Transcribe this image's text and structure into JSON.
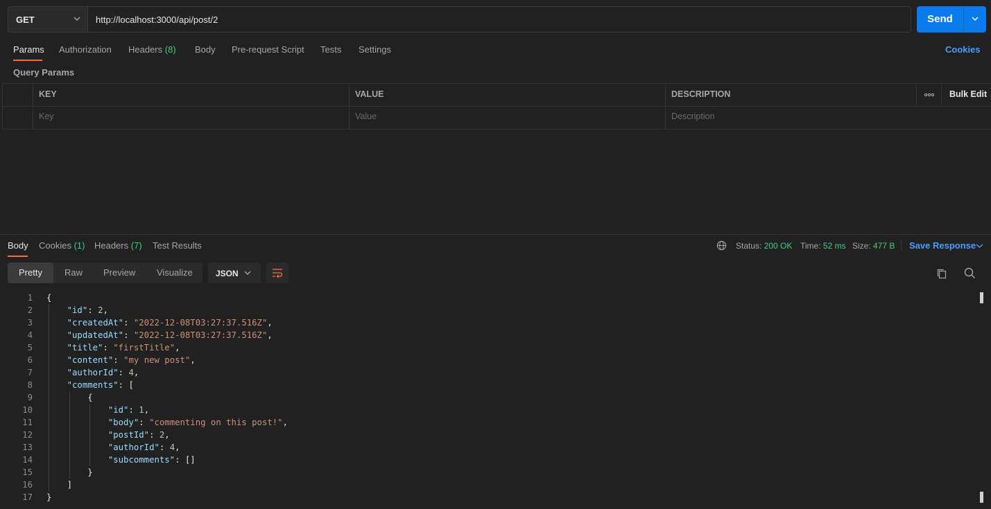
{
  "request": {
    "method": "GET",
    "url": "http://localhost:3000/api/post/2",
    "send_label": "Send"
  },
  "request_tabs": [
    {
      "label": "Params",
      "count": ""
    },
    {
      "label": "Authorization",
      "count": ""
    },
    {
      "label": "Headers",
      "count": "(8)"
    },
    {
      "label": "Body",
      "count": ""
    },
    {
      "label": "Pre-request Script",
      "count": ""
    },
    {
      "label": "Tests",
      "count": ""
    },
    {
      "label": "Settings",
      "count": ""
    }
  ],
  "cookies_link": "Cookies",
  "query_params": {
    "title": "Query Params",
    "columns": [
      "KEY",
      "VALUE",
      "DESCRIPTION"
    ],
    "placeholders": [
      "Key",
      "Value",
      "Description"
    ],
    "bulk_edit": "Bulk Edit"
  },
  "response_tabs": [
    {
      "label": "Body",
      "count": ""
    },
    {
      "label": "Cookies",
      "count": "(1)"
    },
    {
      "label": "Headers",
      "count": "(7)"
    },
    {
      "label": "Test Results",
      "count": ""
    }
  ],
  "response_status": {
    "status_label": "Status:",
    "status_value": "200 OK",
    "time_label": "Time:",
    "time_value": "52 ms",
    "size_label": "Size:",
    "size_value": "477 B",
    "save_label": "Save Response"
  },
  "view_modes": [
    "Pretty",
    "Raw",
    "Preview",
    "Visualize"
  ],
  "format": "JSON",
  "code_lines": [
    "{",
    "    \"id\": 2,",
    "    \"createdAt\": \"2022-12-08T03:27:37.516Z\",",
    "    \"updatedAt\": \"2022-12-08T03:27:37.516Z\",",
    "    \"title\": \"firstTitle\",",
    "    \"content\": \"my new post\",",
    "    \"authorId\": 4,",
    "    \"comments\": [",
    "        {",
    "            \"id\": 1,",
    "            \"body\": \"commenting on this post!\",",
    "            \"postId\": 2,",
    "            \"authorId\": 4,",
    "            \"subcomments\": []",
    "        }",
    "    ]",
    "}"
  ],
  "colors": {
    "accent": "#ff6c37",
    "send": "#097bed",
    "link": "#4a9eff",
    "status_ok": "#3bd27a",
    "json_key": "#9cdcfe",
    "json_string": "#ce9178",
    "json_number": "#b5cea8"
  }
}
